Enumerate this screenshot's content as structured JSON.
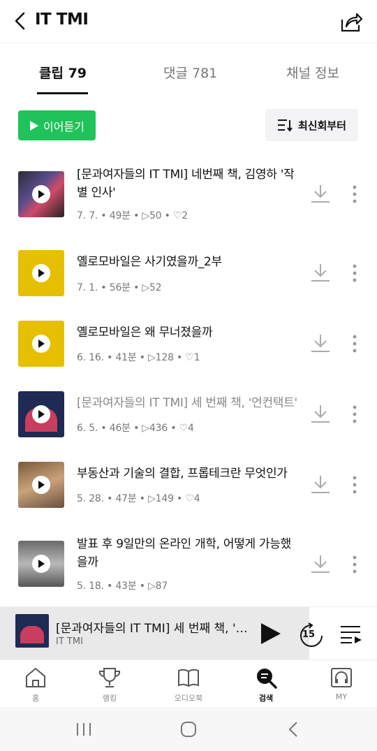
{
  "header": {
    "title": "IT TMI"
  },
  "tabs": [
    {
      "label": "클립 79"
    },
    {
      "label": "댓글 781"
    },
    {
      "label": "채널 정보"
    }
  ],
  "toolbar": {
    "play_all_label": "이어듣기",
    "sort_label": "최신회부터"
  },
  "episodes": [
    {
      "title": "[문과여자들의 IT TMI] 네번째 책, 김영하 '작별 인사'",
      "date": "7. 7.",
      "duration": "49분",
      "plays": "50",
      "likes": "2",
      "played": false
    },
    {
      "title": "옐로모바일은 사기였을까_2부",
      "date": "7. 1.",
      "duration": "56분",
      "plays": "52",
      "likes": "",
      "played": false
    },
    {
      "title": "옐로모바일은 왜 무너졌을까",
      "date": "6. 16.",
      "duration": "41분",
      "plays": "128",
      "likes": "1",
      "played": false
    },
    {
      "title": "[문과여자들의 IT TMI] 세 번째 책, '언컨택트'",
      "date": "6. 5.",
      "duration": "46분",
      "plays": "436",
      "likes": "4",
      "played": true
    },
    {
      "title": "부동산과 기술의 결합, 프롭테크란 무엇인가",
      "date": "5. 28.",
      "duration": "47분",
      "plays": "149",
      "likes": "4",
      "played": false
    },
    {
      "title": "발표 후 9일만의 온라인 개학, 어떻게 가능했을까",
      "date": "5. 18.",
      "duration": "43분",
      "plays": "87",
      "likes": "",
      "played": false
    }
  ],
  "mini_player": {
    "title": "[문과여자들의 IT TMI] 세 번째 책, '언컨택트'",
    "channel": "IT TMI",
    "skip_label": "15",
    "progress": 0.82
  },
  "nav": [
    {
      "label": "홈",
      "icon": "home-icon"
    },
    {
      "label": "랭킹",
      "icon": "trophy-icon"
    },
    {
      "label": "오디오북",
      "icon": "book-icon"
    },
    {
      "label": "검색",
      "icon": "search-icon"
    },
    {
      "label": "MY",
      "icon": "headphones-icon"
    }
  ],
  "colors": {
    "accent": "#1fc35a",
    "text": "#111111",
    "muted": "#777777"
  }
}
